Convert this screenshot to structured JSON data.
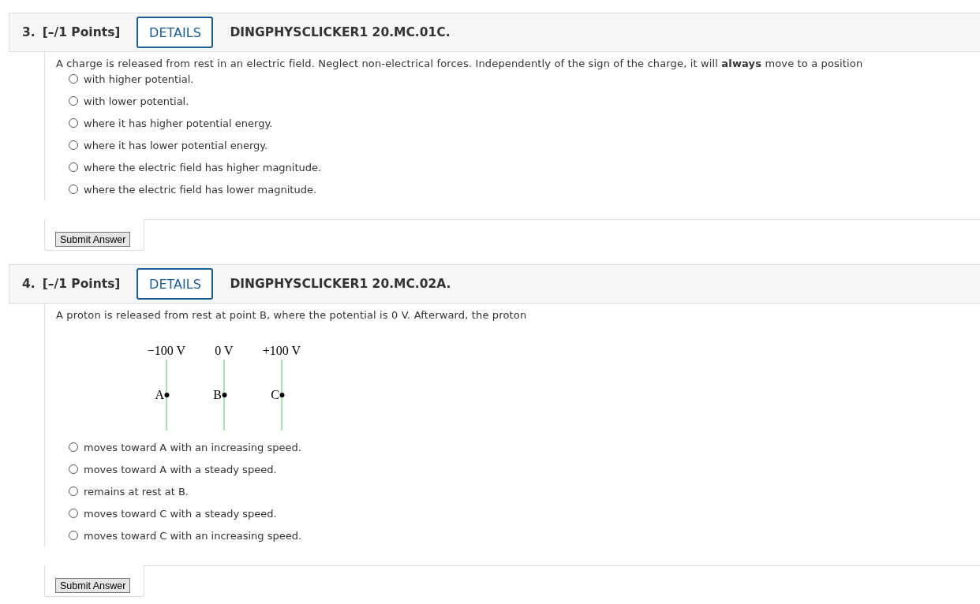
{
  "questions": [
    {
      "number": "3.",
      "points": "[–/1 Points]",
      "details_button": "DETAILS",
      "code": "DINGPHYSCLICKER1 20.MC.01C.",
      "prompt": "A charge is released from rest in an electric field. Neglect non-electrical forces. Independently of the sign of the charge, it will **always** move to a position",
      "options": [
        {
          "label": "with higher potential.",
          "selected": false
        },
        {
          "label": "with lower potential.",
          "selected": false
        },
        {
          "label": "where it has higher potential energy.",
          "selected": false
        },
        {
          "label": "where it has lower potential energy.",
          "selected": false
        },
        {
          "label": "where the electric field has higher magnitude.",
          "selected": false
        },
        {
          "label": "where the electric field has lower magnitude.",
          "selected": false
        }
      ],
      "submit_button": "Submit Answer"
    },
    {
      "number": "4.",
      "points": "[–/1 Points]",
      "details_button": "DETAILS",
      "code": "DINGPHYSCLICKER1 20.MC.02A.",
      "prompt": "A proton is released from rest at point B, where the potential is 0 V. Afterward, the proton",
      "diagram": {
        "plates": [
          {
            "potential": "−100 V",
            "point": "A"
          },
          {
            "potential": "0 V",
            "point": "B"
          },
          {
            "potential": "+100 V",
            "point": "C"
          }
        ]
      },
      "options": [
        {
          "label": "moves toward A with an increasing speed.",
          "selected": false
        },
        {
          "label": "moves toward A with a steady speed.",
          "selected": false
        },
        {
          "label": "remains at rest at B.",
          "selected": false
        },
        {
          "label": "moves toward C with a steady speed.",
          "selected": false
        },
        {
          "label": "moves toward C with an increasing speed.",
          "selected": false
        }
      ],
      "submit_button": "Submit Answer"
    }
  ]
}
